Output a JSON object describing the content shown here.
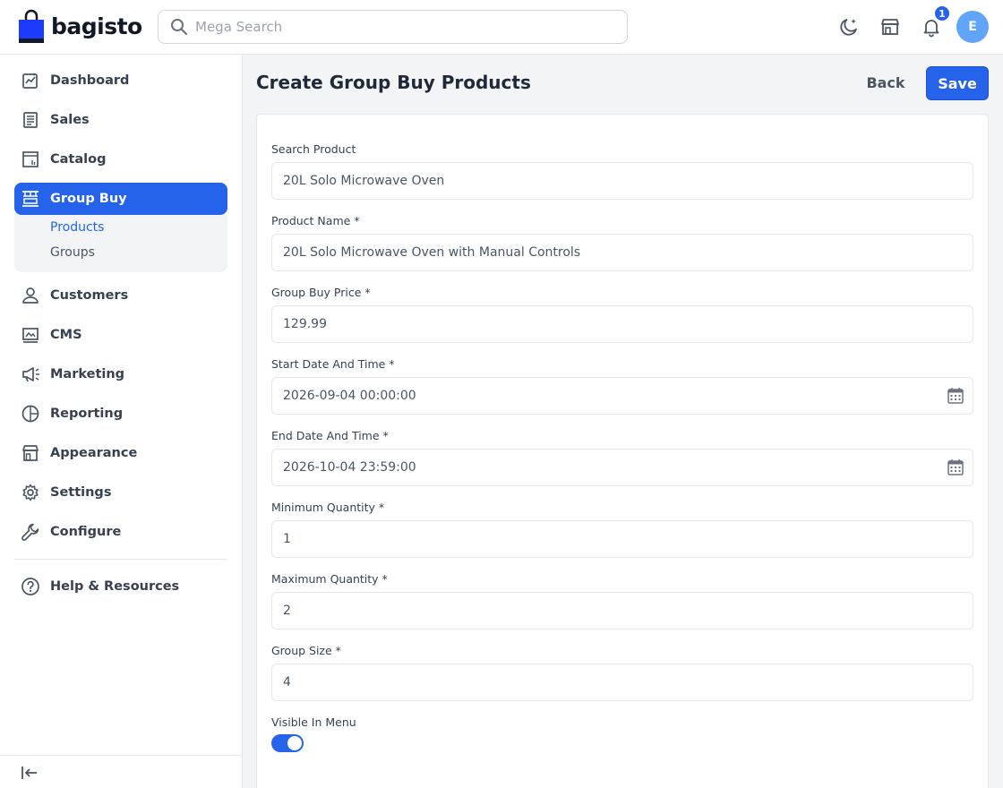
{
  "brand": {
    "name": "bagisto"
  },
  "header": {
    "search_placeholder": "Mega Search",
    "notification_count": "1",
    "avatar_initial": "E"
  },
  "sidebar": {
    "items": [
      {
        "label": "Dashboard",
        "icon": "dashboard-icon"
      },
      {
        "label": "Sales",
        "icon": "sales-icon"
      },
      {
        "label": "Catalog",
        "icon": "catalog-icon"
      },
      {
        "label": "Group Buy",
        "icon": "group-buy-icon",
        "active": true
      },
      {
        "label": "Customers",
        "icon": "customers-icon"
      },
      {
        "label": "CMS",
        "icon": "cms-icon"
      },
      {
        "label": "Marketing",
        "icon": "marketing-icon"
      },
      {
        "label": "Reporting",
        "icon": "reporting-icon"
      },
      {
        "label": "Appearance",
        "icon": "appearance-icon"
      },
      {
        "label": "Settings",
        "icon": "settings-icon"
      },
      {
        "label": "Configure",
        "icon": "configure-icon"
      },
      {
        "label": "Help & Resources",
        "icon": "help-icon"
      }
    ],
    "submenu": [
      {
        "label": "Products",
        "active": true
      },
      {
        "label": "Groups"
      }
    ]
  },
  "page": {
    "title": "Create Group Buy Products",
    "back_label": "Back",
    "save_label": "Save"
  },
  "form": {
    "search_product": {
      "label": "Search Product",
      "value": "20L Solo Microwave Oven"
    },
    "product_name": {
      "label": "Product Name *",
      "value": "20L Solo Microwave Oven with Manual Controls"
    },
    "group_buy_price": {
      "label": "Group Buy Price *",
      "value": "129.99"
    },
    "start_date": {
      "label": "Start Date And Time *",
      "value": "2026-09-04 00:00:00"
    },
    "end_date": {
      "label": "End Date And Time *",
      "value": "2026-10-04 23:59:00"
    },
    "min_qty": {
      "label": "Minimum Quantity *",
      "value": "1"
    },
    "max_qty": {
      "label": "Maximum Quantity *",
      "value": "2"
    },
    "group_size": {
      "label": "Group Size *",
      "value": "4"
    },
    "visible_in_menu": {
      "label": "Visible In Menu",
      "enabled": true
    }
  },
  "colors": {
    "accent": "#2563eb",
    "avatar": "#60a5fa"
  }
}
